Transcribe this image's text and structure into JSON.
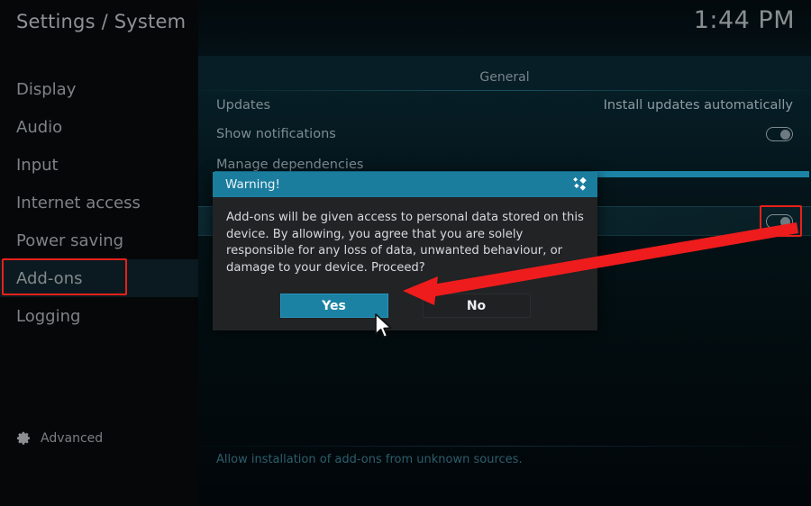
{
  "window": {
    "title": "Settings / System",
    "clock": "1:44 PM"
  },
  "sidebar": {
    "items": [
      {
        "label": "Display",
        "name": "sidebar-item-display",
        "selected": false
      },
      {
        "label": "Audio",
        "name": "sidebar-item-audio",
        "selected": false
      },
      {
        "label": "Input",
        "name": "sidebar-item-input",
        "selected": false
      },
      {
        "label": "Internet access",
        "name": "sidebar-item-internet-access",
        "selected": false
      },
      {
        "label": "Power saving",
        "name": "sidebar-item-power-saving",
        "selected": false
      },
      {
        "label": "Add-ons",
        "name": "sidebar-item-add-ons",
        "selected": true
      },
      {
        "label": "Logging",
        "name": "sidebar-item-logging",
        "selected": false
      }
    ],
    "advanced_label": "Advanced",
    "advanced_icon": "gear-icon"
  },
  "main": {
    "section_title": "General",
    "rows": [
      {
        "label": "Updates",
        "value": "Install updates automatically",
        "control": "text"
      },
      {
        "label": "Show notifications",
        "value": "",
        "control": "toggle",
        "toggle_on": false
      },
      {
        "label": "Manage dependencies",
        "value": "",
        "control": "none"
      }
    ],
    "unknown_sources_row": {
      "label": "",
      "control": "toggle",
      "toggle_on": false
    },
    "footer_description": "Allow installation of add-ons from unknown sources."
  },
  "dialog": {
    "title": "Warning!",
    "logo_icon": "kodi-logo-icon",
    "message": "Add-ons will be given access to personal data stored on this device. By allowing, you agree that you are solely responsible for any loss of data, unwanted behaviour, or damage to your device. Proceed?",
    "yes_label": "Yes",
    "no_label": "No",
    "focused_button": "Yes"
  },
  "annotations": {
    "highlight_color": "#e8211a",
    "arrow_color": "#ee1c1c",
    "accent_color": "#1b7d9e",
    "cursor_icon": "mouse-pointer-icon"
  }
}
